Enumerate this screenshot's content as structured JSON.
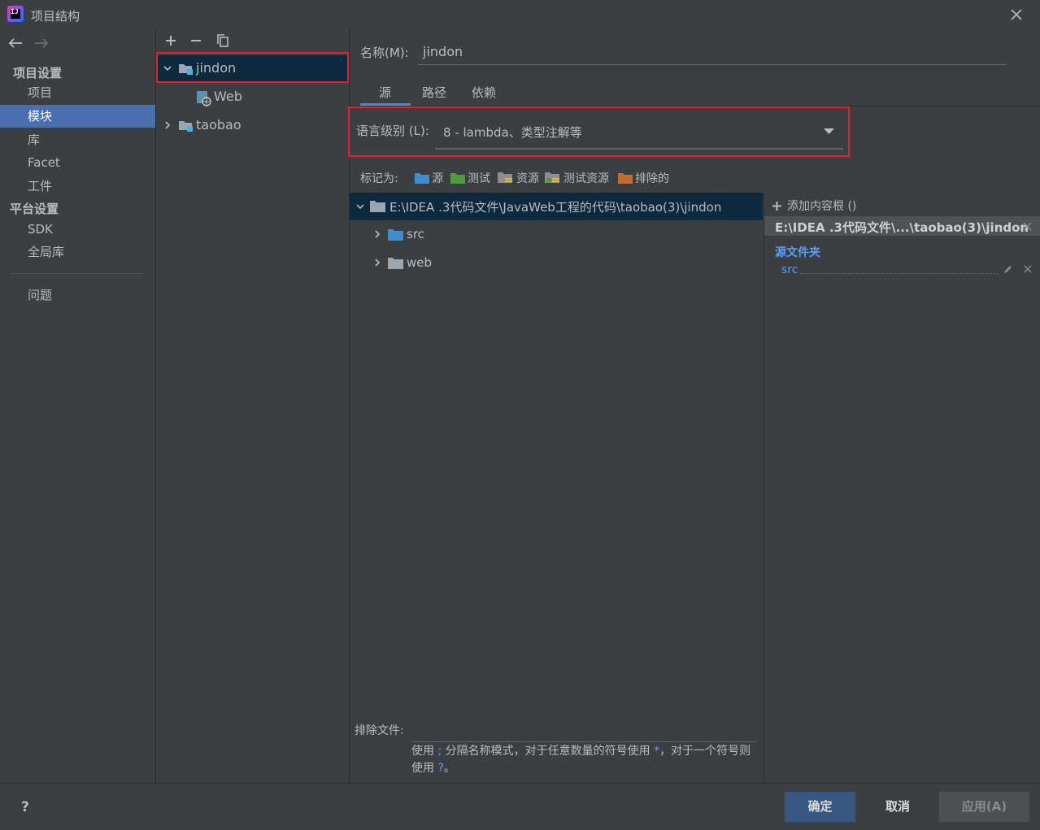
{
  "window": {
    "title": "项目结构"
  },
  "nav": {
    "project_settings_header": "项目设置",
    "project_settings_items": [
      {
        "label": "项目",
        "selected": false
      },
      {
        "label": "模块",
        "selected": true
      },
      {
        "label": "库",
        "selected": false
      },
      {
        "label": "Facet",
        "selected": false
      },
      {
        "label": "工件",
        "selected": false
      }
    ],
    "platform_settings_header": "平台设置",
    "platform_settings_items": [
      {
        "label": "SDK"
      },
      {
        "label": "全局库"
      }
    ],
    "problems_label": "问题"
  },
  "modules": {
    "toolbar": [
      "plus-icon",
      "minus-icon",
      "copy-icon"
    ],
    "tree": [
      {
        "label": "jindon",
        "expanded": true,
        "selected": true,
        "children": [
          {
            "label": "Web"
          }
        ]
      },
      {
        "label": "taobao",
        "expanded": false
      }
    ]
  },
  "module": {
    "name_label": "名称(M):",
    "name_value": "jindon",
    "tabs": [
      {
        "label": "源",
        "active": true
      },
      {
        "label": "路径",
        "active": false
      },
      {
        "label": "依赖",
        "active": false
      }
    ],
    "language_level_label": "语言级别 (L):",
    "language_level_value": "8 - lambda、类型注解等",
    "mark_as_label": "标记为:",
    "mark_as_options": [
      {
        "label": "源",
        "color": "#3d8ed1"
      },
      {
        "label": "测试",
        "color": "#4f9a3e"
      },
      {
        "label": "资源",
        "color": "#8e8e8e"
      },
      {
        "label": "测试资源",
        "color": "#8e8e8e"
      },
      {
        "label": "排除的",
        "color": "#c76b2a"
      }
    ],
    "content_tree": {
      "root": "E:\\IDEA .3代码文件\\JavaWeb工程的代码\\taobao(3)\\jindon",
      "children": [
        {
          "label": "src",
          "color": "#3d8ed1"
        },
        {
          "label": "web",
          "color": "#8e8e8e"
        }
      ]
    },
    "content_root_panel": {
      "add_label": "添加内容根 ()",
      "root_label": "E:\\IDEA .3代码文件\\...\\taobao(3)\\jindon",
      "source_folders_title": "源文件夹",
      "source_folders": [
        "src"
      ]
    },
    "exclude": {
      "label": "排除文件:",
      "value": "",
      "hint_part1": "使用 ",
      "hint_sep": ";",
      "hint_part2": " 分隔名称模式，对于任意数量的符号使用 ",
      "hint_star": "*",
      "hint_part3": "，对于一个符号则使用 ",
      "hint_q": "?",
      "hint_part4": "。"
    }
  },
  "buttons": {
    "help": "?",
    "ok": "确定",
    "cancel": "取消",
    "apply": "应用(A)"
  },
  "colors": {
    "accent": "#4b6eaf",
    "selection_dark": "#0d293e",
    "highlight_box": "#e0232e",
    "link": "#589df6"
  }
}
